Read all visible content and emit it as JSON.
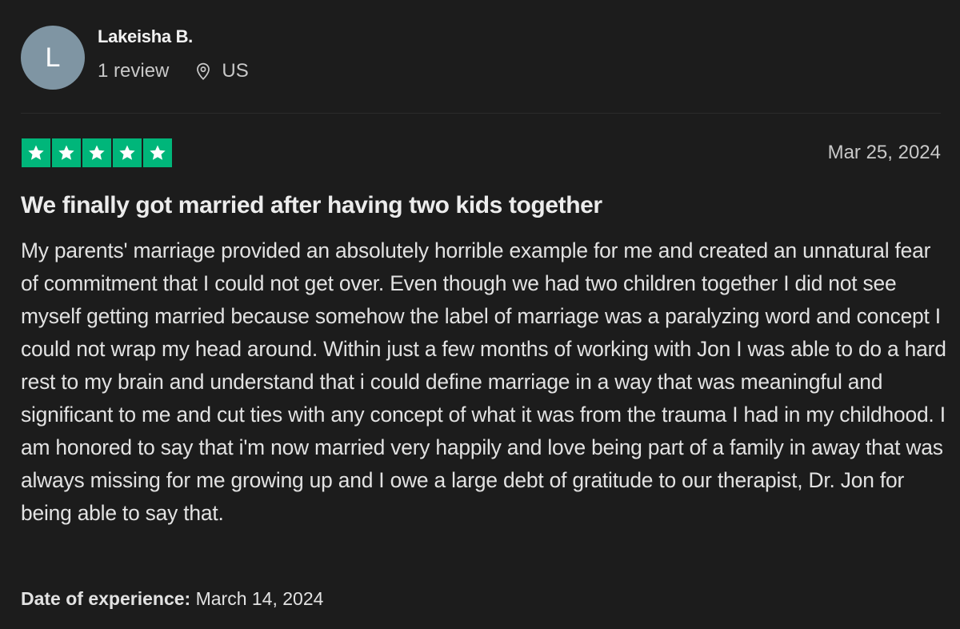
{
  "reviewer": {
    "initial": "L",
    "name": "Lakeisha B.",
    "review_count": "1 review",
    "location_icon": "location-pin-icon",
    "country": "US"
  },
  "rating": {
    "stars": 5,
    "max_stars": 5,
    "star_color": "#00b67a",
    "star_icon": "star-icon"
  },
  "review": {
    "date": "Mar 25, 2024",
    "title": "We finally got married after having two kids together",
    "body": "My parents' marriage provided an absolutely horrible example for me and created an unnatural fear of commitment that I could not get over. Even though we had two children together I did not see myself getting married because somehow the label of marriage was a paralyzing word and concept I could not wrap my head around. Within just a few months of working with Jon I was able to do a hard rest to my brain and understand that i could define marriage in a way that was meaningful and significant to me and cut ties with any concept of what it was from the trauma I had in my childhood. I am honored to say that i'm now married very happily and love being part of a family in away that was always missing for me growing up and I owe a large debt of gratitude to our therapist, Dr. Jon for being able to say that.",
    "experience_label": "Date of experience:",
    "experience_date": "March 14, 2024"
  },
  "colors": {
    "background": "#1c1c1c",
    "avatar": "#7f95a3",
    "accent_green": "#00b67a"
  }
}
